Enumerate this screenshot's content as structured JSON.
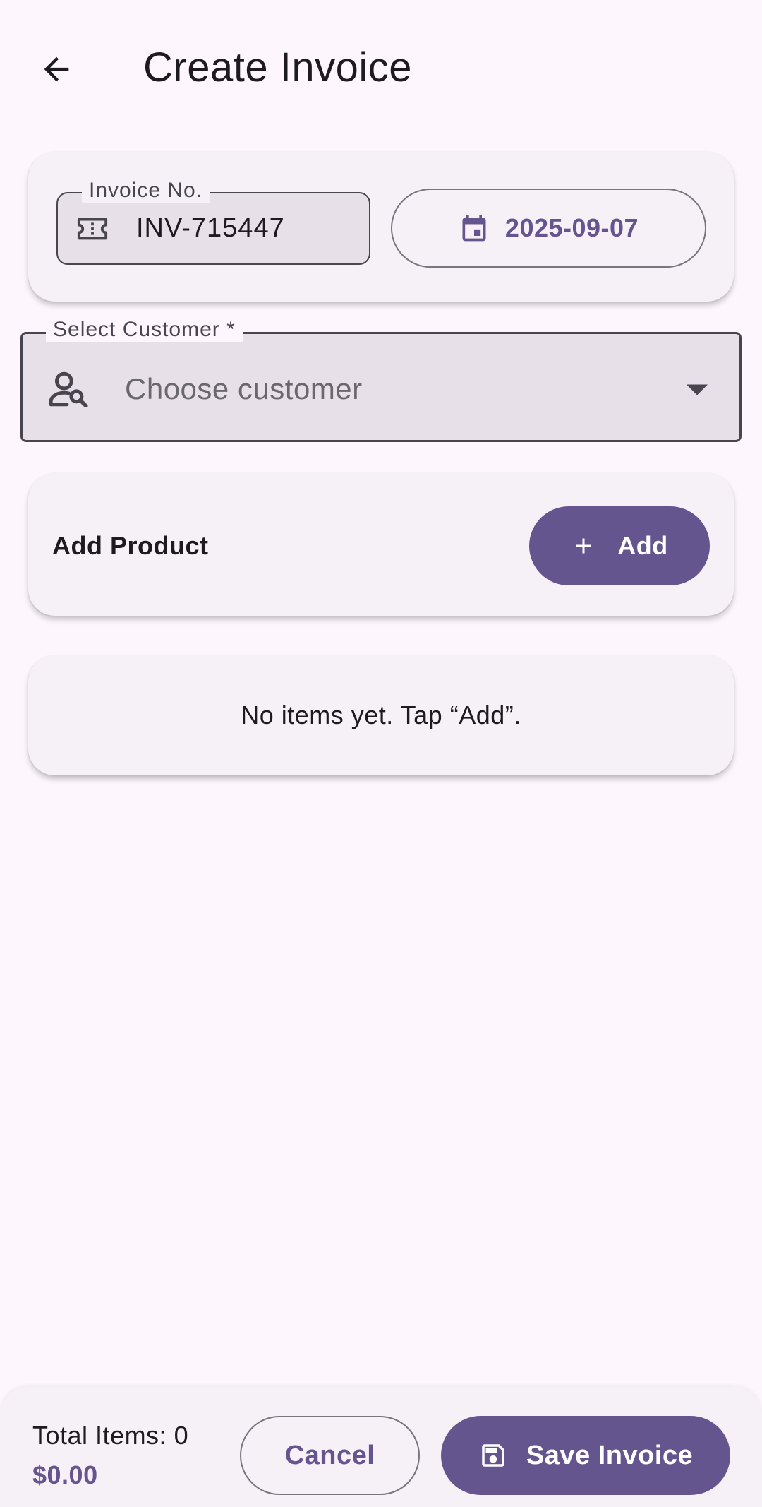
{
  "app_bar": {
    "title": "Create Invoice",
    "back_icon": "arrow-back-icon"
  },
  "invoice": {
    "label": "Invoice No.",
    "value": "INV-715447",
    "icon": "ticket-icon"
  },
  "date": {
    "value": "2025-09-07",
    "icon": "calendar-icon"
  },
  "customer": {
    "label": "Select Customer *",
    "placeholder": "Choose customer",
    "icon": "person-search-icon",
    "dropdown_icon": "arrow-drop-down-icon"
  },
  "add_product": {
    "title": "Add Product",
    "button_label": "Add",
    "button_icon": "plus-icon"
  },
  "items": {
    "empty_message": "No items yet. Tap “Add”."
  },
  "footer": {
    "total_items": "Total Items: 0",
    "total_amount": "$0.00",
    "cancel_label": "Cancel",
    "save_label": "Save Invoice",
    "save_icon": "save-icon"
  },
  "colors": {
    "primary": "#65558F",
    "background": "#FDF7FD",
    "surface": "#F6F1F7",
    "field_fill": "#E7E0E8",
    "on_surface": "#1D1B20",
    "outline": "#79747E"
  }
}
